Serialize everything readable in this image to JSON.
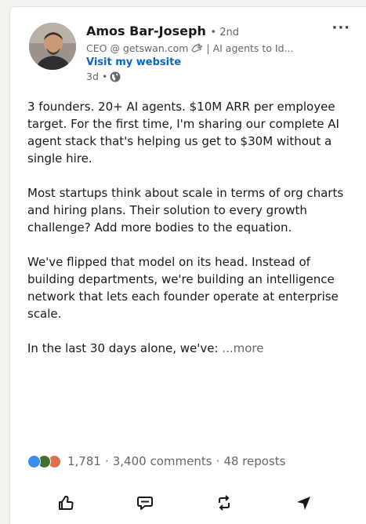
{
  "author": {
    "name": "Amos Bar-Joseph",
    "degree": "• 2nd",
    "headline_prefix": "CEO @ getswan.com",
    "headline_suffix": "| AI agents to Id...",
    "website_label": "Visit my website",
    "time_ago": "3d •"
  },
  "menu": {
    "more_label": "···"
  },
  "post": {
    "paragraphs": [
      "3 founders. 20+ AI agents. $10M ARR per employee target. For the first time, I'm sharing our complete AI agent stack that's helping us get to $30M without a single hire.",
      "Most startups think about scale in terms of org charts and hiring plans. Their solution to every growth challenge? Add more bodies to the equation.",
      "We've flipped that model on its head. Instead of building departments, we're building an intelligence network that lets each founder operate at enterprise scale."
    ],
    "last_line": "In the last 30 days alone, we've: ",
    "see_more": "...more"
  },
  "social": {
    "reaction_count": "1,781",
    "comments": "3,400 comments",
    "reposts": "48 reposts",
    "separator": "·",
    "reaction_types": [
      "like",
      "celebrate",
      "love"
    ]
  },
  "actions": [
    {
      "icon": "thumbs-up-icon"
    },
    {
      "icon": "comment-icon"
    },
    {
      "icon": "repost-icon"
    },
    {
      "icon": "send-icon"
    }
  ],
  "colors": {
    "link": "#0a66c2",
    "muted": "#666666",
    "text": "#191919",
    "like": "#378fe9",
    "celebrate": "#44712e",
    "love": "#df704d"
  }
}
